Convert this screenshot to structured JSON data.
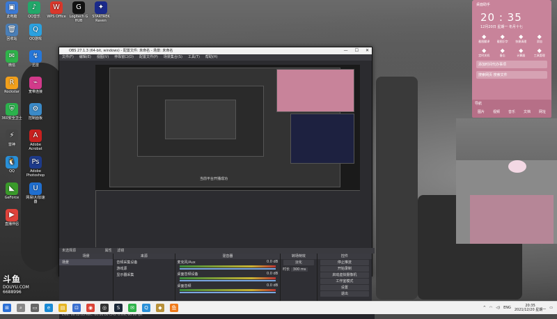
{
  "notification": {
    "header": "桌面助手",
    "time": "20 : 35",
    "date": "12月20日  星期一",
    "lunar": "冬月十七",
    "quick": [
      {
        "icon": "screenshot-icon",
        "label": "截图翻译"
      },
      {
        "icon": "doc-icon",
        "label": "截图识字"
      },
      {
        "icon": "video-icon",
        "label": "快捷清理"
      },
      {
        "icon": "calc-icon",
        "label": "添加"
      }
    ],
    "quick2": [
      {
        "icon": "timer-icon",
        "label": "定时关机"
      },
      {
        "icon": "note-icon",
        "label": "备忘"
      },
      {
        "icon": "calculator-icon",
        "label": "计算器"
      },
      {
        "icon": "toolbox-icon",
        "label": "工具管理"
      }
    ],
    "line1": "添加时间代办事项",
    "line2": "搜索网页  搜索文件",
    "bar_title": "导航",
    "bar_items": [
      "图片",
      "视频",
      "音乐",
      "文档",
      "网址"
    ]
  },
  "obs": {
    "title": "OBS 27.1.3 (64-bit, windows) - 配置文件: 未命名 - 场景: 未命名",
    "menu": [
      "文件(F)",
      "编辑(E)",
      "视图(V)",
      "停靠窗口(D)",
      "配置文件(P)",
      "场景集合(S)",
      "工具(T)",
      "帮助(H)"
    ],
    "source_label": "未选择源",
    "props_btn": "属性",
    "filter_btn": "滤镜",
    "docks": {
      "scenes": {
        "title": "场景",
        "items": [
          "场景"
        ]
      },
      "sources": {
        "title": "来源",
        "items": [
          "音频采集设备",
          "游戏源",
          "显示器采集"
        ]
      },
      "mixer": {
        "title": "混音器",
        "tracks": [
          {
            "name": "麦克风/Aux",
            "db": "0.0 dB"
          },
          {
            "name": "桌面音频设备",
            "db": "0.0 dB"
          },
          {
            "name": "桌面音频",
            "db": "0.0 dB"
          }
        ]
      },
      "transitions": {
        "title": "转场特效",
        "type": "淡化",
        "duration_label": "时长",
        "duration": "300 ms"
      },
      "controls": {
        "title": "控件",
        "buttons": [
          "停止推流",
          "开始录制",
          "启动虚拟摄像机",
          "工作室模式",
          "设置",
          "退出"
        ]
      }
    },
    "status": "LIVE: 00:12:05   REC: 00:00:00   CPU: 0.4%, 60.00 fps",
    "nested_toast": "当前平台开播成功"
  },
  "desktop_icons": [
    {
      "label": "此电脑",
      "color": "#3b7ad6",
      "glyph": "▣"
    },
    {
      "label": "QQ音乐",
      "color": "#22a86a",
      "glyph": "♪"
    },
    {
      "label": "WPS Office",
      "color": "#d9372b",
      "glyph": "W"
    },
    {
      "label": "Logitech G HUB",
      "color": "#111111",
      "glyph": "G"
    },
    {
      "label": "STARTREK Raven",
      "color": "#1a2a8a",
      "glyph": "✦"
    },
    {
      "label": "回收站",
      "color": "#4a7fb8",
      "glyph": "🗑"
    },
    {
      "label": "QQ游戏",
      "color": "#2aa1e0",
      "glyph": "Q"
    },
    {
      "label": "微信",
      "color": "#2fb34a",
      "glyph": "✉"
    },
    {
      "label": "迅雷",
      "color": "#2677d9",
      "glyph": "↯"
    },
    {
      "label": "Rockstar",
      "color": "#f2a01b",
      "glyph": "R"
    },
    {
      "label": "宽带连接",
      "color": "#d23a8a",
      "glyph": "⌁"
    },
    {
      "label": "360安全卫士",
      "color": "#2bb24c",
      "glyph": "⛨"
    },
    {
      "label": "控制面板",
      "color": "#3a8ac8",
      "glyph": "⚙"
    },
    {
      "label": "雷神",
      "color": "#444",
      "glyph": "⚡"
    },
    {
      "label": "Adobe Acrobat",
      "color": "#c8201e",
      "glyph": "A"
    },
    {
      "label": "QQ",
      "color": "#2a90d8",
      "glyph": "🐧"
    },
    {
      "label": "Adobe Photoshop",
      "color": "#1d3a8a",
      "glyph": "Ps"
    },
    {
      "label": "GeForce",
      "color": "#3a9a2a",
      "glyph": "◣"
    },
    {
      "label": "网易UU加速器",
      "color": "#1f6fd0",
      "glyph": "U"
    },
    {
      "label": "直播伴侣",
      "color": "#e0423a",
      "glyph": "▶"
    }
  ],
  "taskbar": {
    "apps": [
      {
        "icon": "windows-start-icon",
        "color": "#2a6fd6",
        "glyph": "⊞"
      },
      {
        "icon": "search-icon",
        "color": "#888",
        "glyph": "⌕"
      },
      {
        "icon": "task-view-icon",
        "color": "#666",
        "glyph": "▭"
      },
      {
        "icon": "edge-icon",
        "color": "#1a8ad4",
        "glyph": "e"
      },
      {
        "icon": "file-explorer-icon",
        "color": "#e6b422",
        "glyph": "▤"
      },
      {
        "icon": "store-icon",
        "color": "#3a6fd0",
        "glyph": "⊡"
      },
      {
        "icon": "chrome-icon",
        "color": "#db4437",
        "glyph": "◉"
      },
      {
        "icon": "obs-icon",
        "color": "#333",
        "glyph": "◎"
      },
      {
        "icon": "steam-icon",
        "color": "#1b2838",
        "glyph": "S"
      },
      {
        "icon": "wechat-icon",
        "color": "#2fb34a",
        "glyph": "✉"
      },
      {
        "icon": "qq-icon",
        "color": "#2a90d8",
        "glyph": "Q"
      },
      {
        "icon": "league-icon",
        "color": "#b8913a",
        "glyph": "◆"
      },
      {
        "icon": "douyu-icon",
        "color": "#f07a1a",
        "glyph": "鱼"
      }
    ],
    "lang": "ENG",
    "time": "20:35",
    "date": "2021/12/20 星期一"
  },
  "watermark": {
    "brand": "斗鱼",
    "site": "DOUYU.COM",
    "room": "6688996"
  }
}
